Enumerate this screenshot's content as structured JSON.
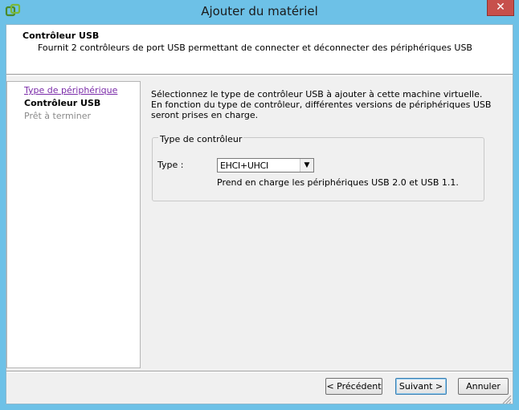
{
  "window": {
    "title": "Ajouter du matériel",
    "close_glyph": "✕",
    "icon": "vsphere-app-icon"
  },
  "header": {
    "title": "Contrôleur USB",
    "description": "Fournit 2 contrôleurs de port USB permettant de connecter et déconnecter des périphériques USB"
  },
  "nav": {
    "items": [
      {
        "label": "Type de périphérique",
        "state": "link"
      },
      {
        "label": "Contrôleur USB",
        "state": "current"
      },
      {
        "label": "Prêt à terminer",
        "state": "disabled"
      }
    ]
  },
  "content": {
    "intro": "Sélectionnez le type de contrôleur USB à ajouter à cette machine virtuelle. En fonction du type de contrôleur, différentes versions de périphériques USB seront prises en charge.",
    "group_title": "Type de contrôleur",
    "type_label": "Type :",
    "type_value": "EHCI+UHCI",
    "type_help": "Prend en charge les périphériques USB 2.0 et USB 1.1."
  },
  "buttons": {
    "prev": "< Précédent",
    "next": "Suivant >",
    "cancel": "Annuler"
  },
  "colors": {
    "titlebar": "#6dc1e7",
    "close": "#c7504c",
    "link": "#7a2aa8"
  }
}
